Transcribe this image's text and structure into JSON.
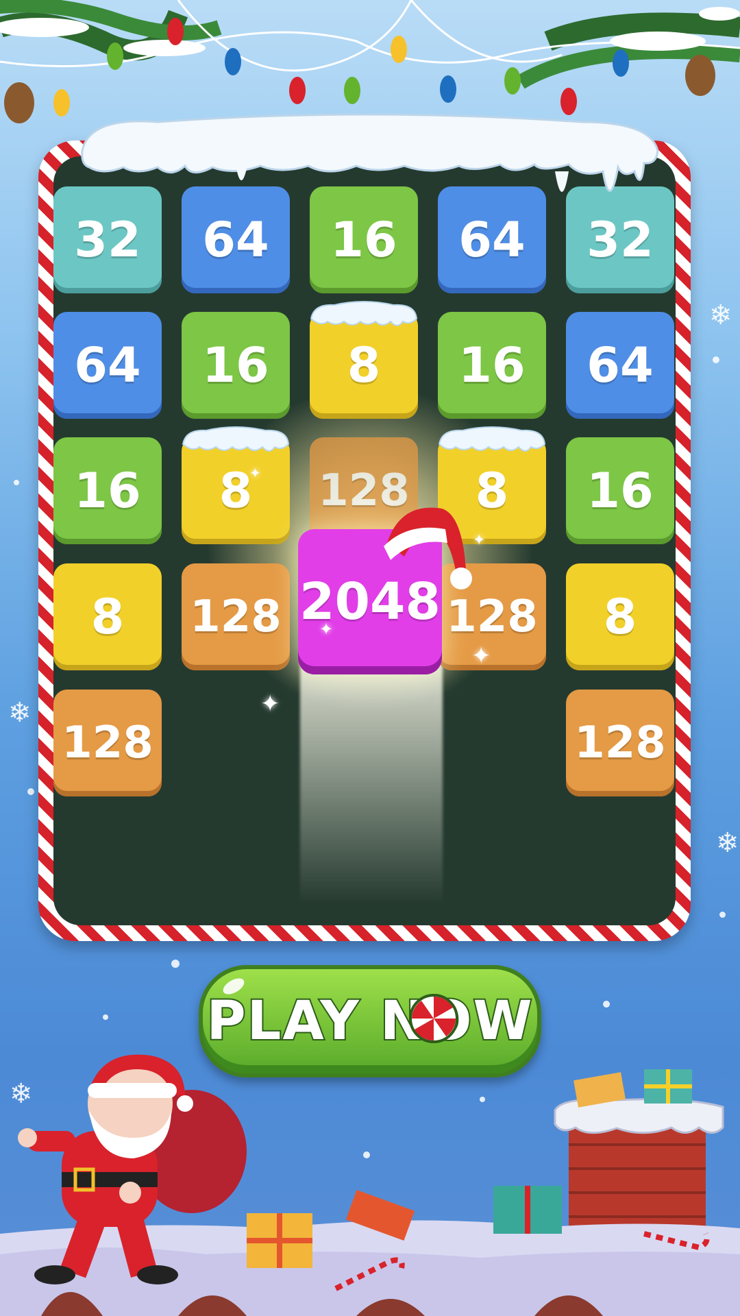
{
  "game": {
    "grid": [
      [
        "32",
        "64",
        "16",
        "64",
        "32"
      ],
      [
        "64",
        "16",
        "8",
        "16",
        "64"
      ],
      [
        "16",
        "8",
        "128",
        "8",
        "16"
      ],
      [
        "8",
        "128",
        "",
        "128",
        "8"
      ],
      [
        "128",
        "",
        "",
        "",
        "128"
      ]
    ],
    "highlight_tile": "2048",
    "play_button_label": "PLAY NOW",
    "colors": {
      "tile_32": "#6cc7c4",
      "tile_64": "#4f8ee6",
      "tile_16": "#7dc646",
      "tile_8": "#f2d02a",
      "tile_128": "#e59a45",
      "tile_2048": "#e13ee8",
      "board": "#253a2f",
      "button": "#7cc83a"
    },
    "icons": [
      "santa-hat-icon",
      "sparkle-icon",
      "snowflake-icon",
      "candy-peppermint-icon",
      "gift-icon",
      "santa-icon",
      "chimney-icon",
      "candy-cane-icon",
      "christmas-lights-icon"
    ]
  }
}
